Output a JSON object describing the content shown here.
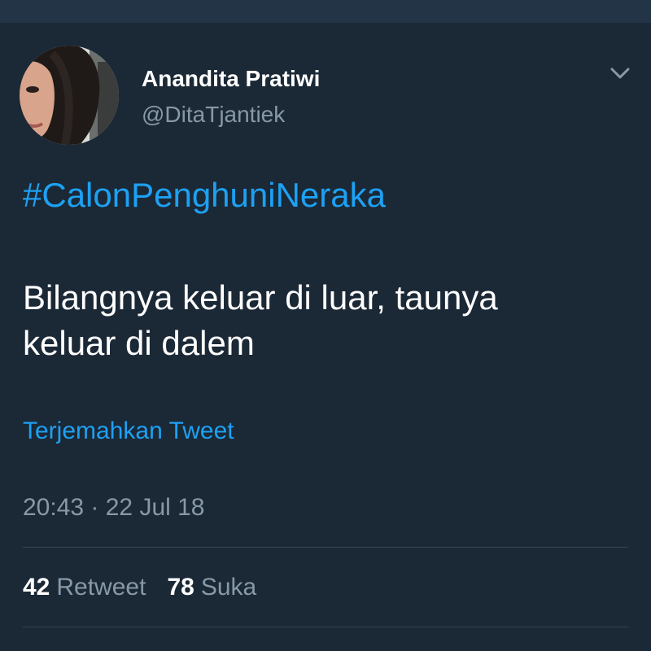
{
  "tweet": {
    "author": {
      "display_name": "Anandita Pratiwi",
      "handle": "@DitaTjantiek"
    },
    "hashtag": "#CalonPenghuniNeraka",
    "body_lines": [
      "Bilangnya keluar di luar, taunya",
      "keluar di dalem"
    ],
    "translate_label": "Terjemahkan Tweet",
    "timestamp": "20:43 · 22 Jul 18",
    "stats": {
      "retweets_count": "42",
      "retweets_label": "Retweet",
      "likes_count": "78",
      "likes_label": "Suka"
    }
  },
  "icons": {
    "more_menu": "chevron-down-icon"
  },
  "colors": {
    "background": "#1b2836",
    "top_bar": "#243447",
    "link": "#1da1f2",
    "primary_text": "#ffffff",
    "secondary_text": "#8899a6",
    "divider": "#38444d"
  }
}
